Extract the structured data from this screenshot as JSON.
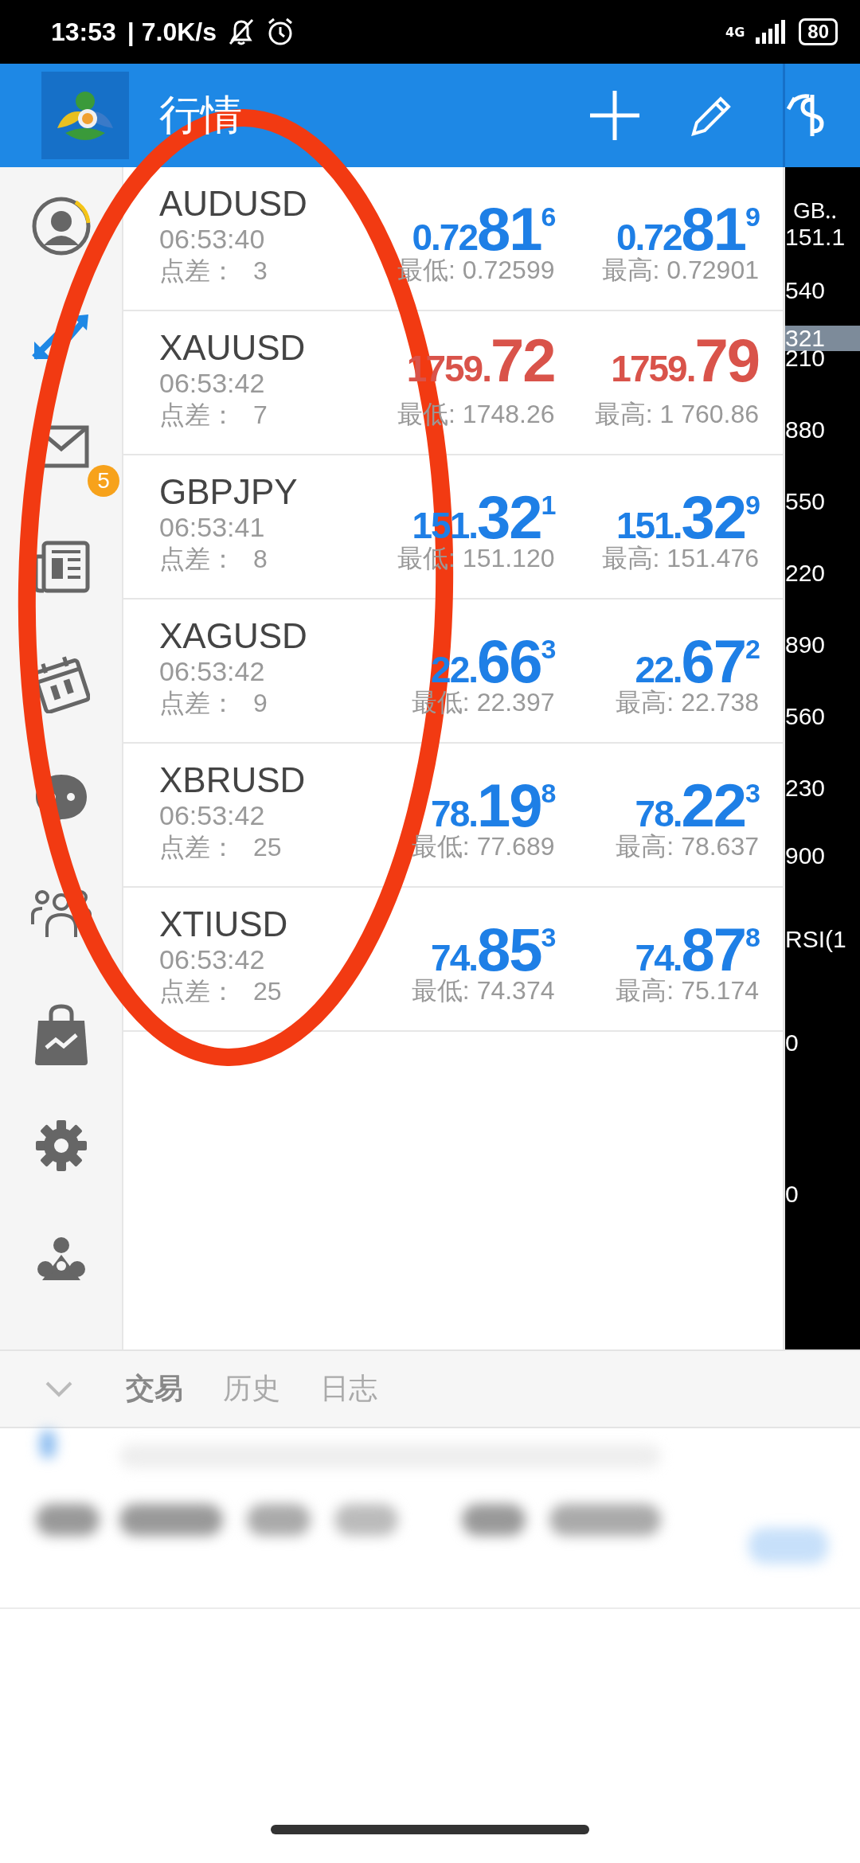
{
  "status_bar": {
    "time": "13:53",
    "speed": "| 7.0K/s",
    "network": "4G",
    "battery": "80"
  },
  "app_bar": {
    "title": "行情"
  },
  "sidebar": {
    "items": [
      {
        "kind": "account",
        "selected": false
      },
      {
        "kind": "quotes",
        "selected": true
      },
      {
        "kind": "mail",
        "selected": false,
        "badge": "5"
      },
      {
        "kind": "news",
        "selected": false
      },
      {
        "kind": "calendar",
        "selected": false
      },
      {
        "kind": "chat",
        "selected": false
      },
      {
        "kind": "community",
        "selected": false
      },
      {
        "kind": "market",
        "selected": false
      },
      {
        "kind": "settings",
        "selected": false
      },
      {
        "kind": "traders",
        "selected": false
      }
    ]
  },
  "quotes": [
    {
      "symbol": "AUDUSD",
      "time": "06:53:40",
      "spread_label": "点差：",
      "spread": "3",
      "falling": false,
      "bid": {
        "prefix": "0.72",
        "big": "81",
        "sup": "6"
      },
      "ask": {
        "prefix": "0.72",
        "big": "81",
        "sup": "9"
      },
      "low": "最低: 0.72599",
      "high": "最高: 0.72901"
    },
    {
      "symbol": "XAUUSD",
      "time": "06:53:42",
      "spread_label": "点差：",
      "spread": "7",
      "falling": true,
      "bid": {
        "prefix": "1759.",
        "big": "72"
      },
      "ask": {
        "prefix": "1759.",
        "big": "79"
      },
      "low": "最低: 1748.26",
      "high": "最高: 1 760.86"
    },
    {
      "symbol": "GBPJPY",
      "time": "06:53:41",
      "spread_label": "点差：",
      "spread": "8",
      "falling": false,
      "bid": {
        "prefix": "151.",
        "big": "32",
        "sup": "1"
      },
      "ask": {
        "prefix": "151.",
        "big": "32",
        "sup": "9"
      },
      "low": "最低: 151.120",
      "high": "最高: 151.476"
    },
    {
      "symbol": "XAGUSD",
      "time": "06:53:42",
      "spread_label": "点差：",
      "spread": "9",
      "falling": false,
      "bid": {
        "prefix": "22.",
        "big": "66",
        "sup": "3"
      },
      "ask": {
        "prefix": "22.",
        "big": "67",
        "sup": "2"
      },
      "low": "最低: 22.397",
      "high": "最高: 22.738"
    },
    {
      "symbol": "XBRUSD",
      "time": "06:53:42",
      "spread_label": "点差：",
      "spread": "25",
      "falling": false,
      "bid": {
        "prefix": "78.",
        "big": "19",
        "sup": "8"
      },
      "ask": {
        "prefix": "78.",
        "big": "22",
        "sup": "3"
      },
      "low": "最低: 77.689",
      "high": "最高: 78.637"
    },
    {
      "symbol": "XTIUSD",
      "time": "06:53:42",
      "spread_label": "点差：",
      "spread": "25",
      "falling": false,
      "bid": {
        "prefix": "74.",
        "big": "85",
        "sup": "3"
      },
      "ask": {
        "prefix": "74.",
        "big": "87",
        "sup": "8"
      },
      "low": "最低: 74.374",
      "high": "最高: 75.174"
    }
  ],
  "chart_panel": {
    "labels": [
      {
        "text": "GB‥",
        "kind": "title"
      },
      {
        "text": "151.1",
        "kind": "price"
      },
      {
        "text": "540",
        "kind": "axis"
      },
      {
        "text": "321",
        "kind": "current"
      },
      {
        "text": "210",
        "kind": "axis"
      },
      {
        "text": "880",
        "kind": "axis"
      },
      {
        "text": "550",
        "kind": "axis"
      },
      {
        "text": "220",
        "kind": "axis"
      },
      {
        "text": "890",
        "kind": "axis"
      },
      {
        "text": "560",
        "kind": "axis"
      },
      {
        "text": "230",
        "kind": "axis"
      },
      {
        "text": "900",
        "kind": "axis"
      },
      {
        "text": "RSI(1",
        "kind": "indicator"
      },
      {
        "text": "0",
        "kind": "axis"
      },
      {
        "text": "0",
        "kind": "axis"
      }
    ]
  },
  "bottom_tabs": [
    {
      "label": "交易",
      "selected": true
    },
    {
      "label": "历史",
      "selected": false
    },
    {
      "label": "日志",
      "selected": false
    }
  ]
}
